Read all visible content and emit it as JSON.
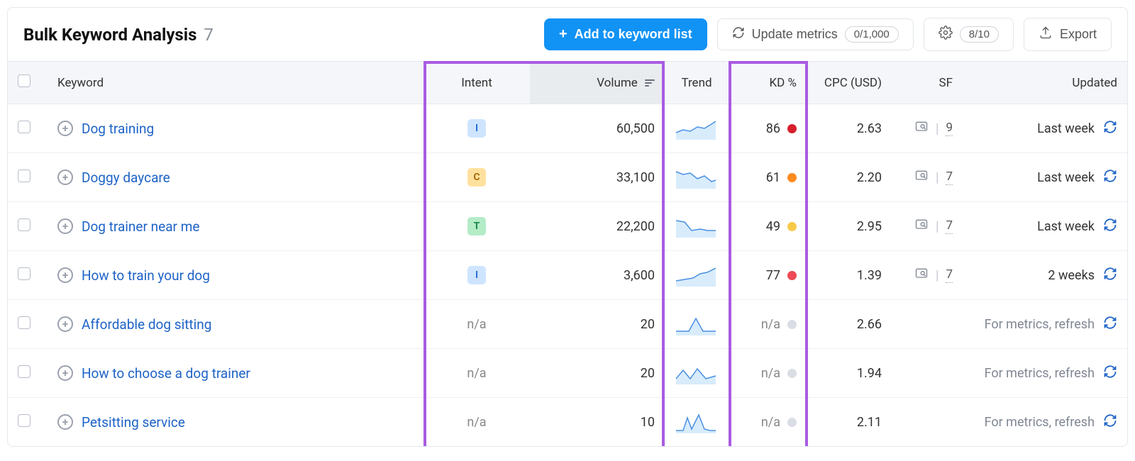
{
  "header": {
    "title": "Bulk Keyword Analysis",
    "count": "7",
    "add_btn": "Add to keyword list",
    "update_btn": "Update metrics",
    "update_pill": "0/1,000",
    "settings_pill": "8/10",
    "export_btn": "Export"
  },
  "columns": {
    "keyword": "Keyword",
    "intent": "Intent",
    "volume": "Volume",
    "trend": "Trend",
    "kd": "KD %",
    "cpc": "CPC (USD)",
    "sf": "SF",
    "updated": "Updated"
  },
  "intent_labels": {
    "I": "I",
    "C": "C",
    "T": "T",
    "na": "n/a"
  },
  "messages": {
    "refresh_prompt": "For metrics, refresh"
  },
  "rows": [
    {
      "keyword": "Dog training",
      "intent": "I",
      "volume": "60,500",
      "trend": "up",
      "kd": "86",
      "kd_color": "#d6202c",
      "cpc": "2.63",
      "sf": "9",
      "updated": "Last week",
      "muted": false
    },
    {
      "keyword": "Doggy daycare",
      "intent": "C",
      "volume": "33,100",
      "trend": "down",
      "kd": "61",
      "kd_color": "#ff8a1f",
      "cpc": "2.20",
      "sf": "7",
      "updated": "Last week",
      "muted": false
    },
    {
      "keyword": "Dog trainer near me",
      "intent": "T",
      "volume": "22,200",
      "trend": "down2",
      "kd": "49",
      "kd_color": "#f7c948",
      "cpc": "2.95",
      "sf": "7",
      "updated": "Last week",
      "muted": false
    },
    {
      "keyword": "How to train your dog",
      "intent": "I",
      "volume": "3,600",
      "trend": "up2",
      "kd": "77",
      "kd_color": "#ee4a56",
      "cpc": "1.39",
      "sf": "7",
      "updated": "2 weeks",
      "muted": false
    },
    {
      "keyword": "Affordable dog sitting",
      "intent": "na",
      "volume": "20",
      "trend": "spike",
      "kd": "n/a",
      "kd_color": "#d9dde4",
      "cpc": "2.66",
      "sf": "",
      "updated": "For metrics, refresh",
      "muted": true
    },
    {
      "keyword": "How to choose a dog trainer",
      "intent": "na",
      "volume": "20",
      "trend": "zigzag",
      "kd": "n/a",
      "kd_color": "#d9dde4",
      "cpc": "1.94",
      "sf": "",
      "updated": "For metrics, refresh",
      "muted": true
    },
    {
      "keyword": "Petsitting service",
      "intent": "na",
      "volume": "10",
      "trend": "peaks",
      "kd": "n/a",
      "kd_color": "#d9dde4",
      "cpc": "2.11",
      "sf": "",
      "updated": "For metrics, refresh",
      "muted": true
    }
  ]
}
